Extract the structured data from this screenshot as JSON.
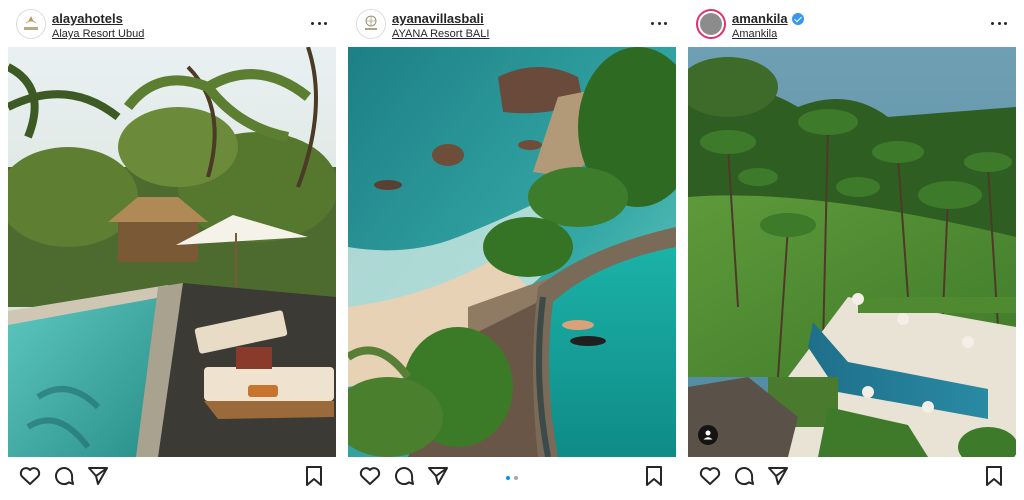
{
  "posts": [
    {
      "username": "alayahotels",
      "location": "Alaya Resort Ubud",
      "avatar_text": "ALAYA",
      "verified": false,
      "photo_icon": "resort-pool-cabana-photo"
    },
    {
      "username": "ayanavillasbali",
      "location": "AYANA Resort BALI",
      "avatar_text": "AYANA",
      "verified": false,
      "photo_icon": "cliff-pool-ocean-photo",
      "carousel": {
        "count": 2,
        "active": 1
      }
    },
    {
      "username": "amankila",
      "location": "Amankila",
      "verified": true,
      "photo_icon": "aerial-palm-pool-photo"
    }
  ],
  "icons": {
    "like": "heart-icon",
    "comment": "comment-icon",
    "share": "paper-plane-icon",
    "save": "bookmark-icon",
    "more": "more-options-icon",
    "tag": "user-tag-icon"
  },
  "colors": {
    "text": "#262626",
    "verified": "#3897f0",
    "carousel_active": "#0095f6",
    "story_ring": "#e1306c"
  }
}
